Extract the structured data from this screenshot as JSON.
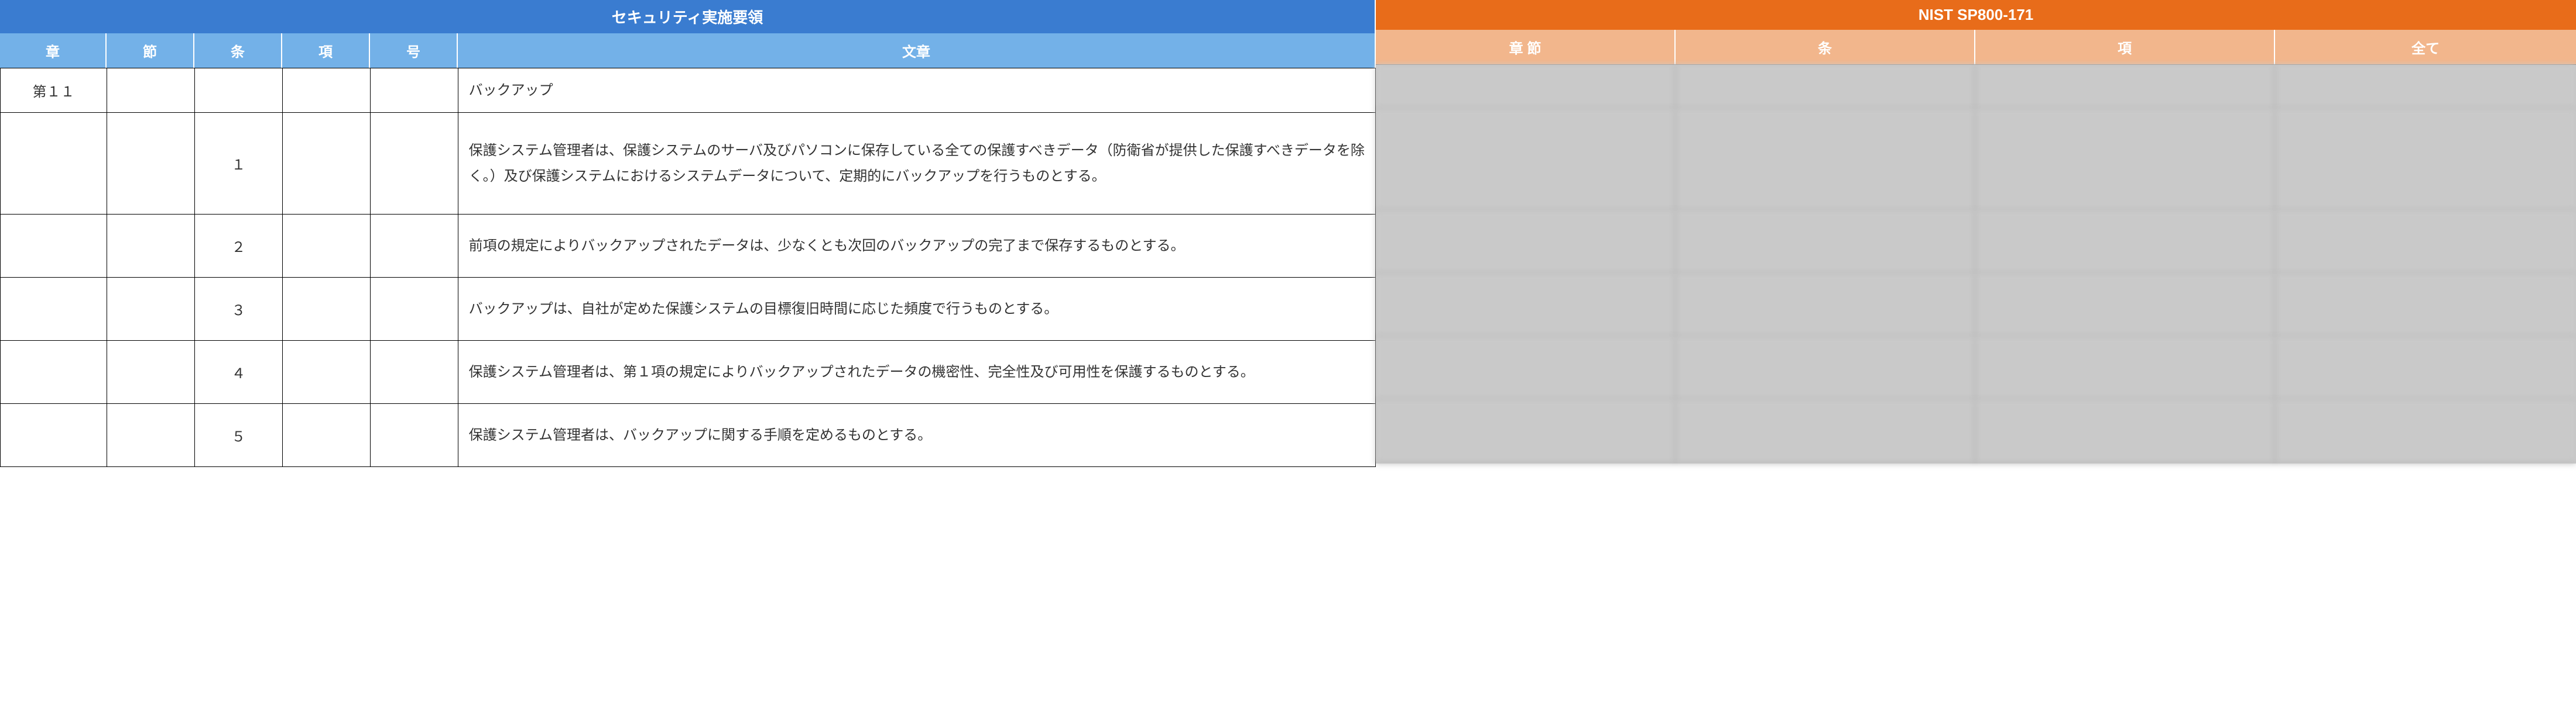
{
  "left": {
    "title": "セキュリティ実施要領",
    "headers": {
      "sho": "章",
      "setsu": "節",
      "jo": "条",
      "kou": "項",
      "gou": "号",
      "bun": "文章"
    },
    "rows": [
      {
        "sho": "第１１",
        "setsu": "",
        "jo": "",
        "kou": "",
        "gou": "",
        "bun": "バックアップ"
      },
      {
        "sho": "",
        "setsu": "",
        "jo": "１",
        "kou": "",
        "gou": "",
        "bun": "保護システム管理者は、保護システムのサーバ及びパソコンに保存している全ての保護すべきデータ（防衛省が提供した保護すべきデータを除く。）及び保護システムにおけるシステムデータについて、定期的にバックアップを行うものとする。"
      },
      {
        "sho": "",
        "setsu": "",
        "jo": "２",
        "kou": "",
        "gou": "",
        "bun": "前項の規定によりバックアップされたデータは、少なくとも次回のバックアップの完了まで保存するものとする。"
      },
      {
        "sho": "",
        "setsu": "",
        "jo": "３",
        "kou": "",
        "gou": "",
        "bun": "バックアップは、自社が定めた保護システムの目標復旧時間に応じた頻度で行うものとする。"
      },
      {
        "sho": "",
        "setsu": "",
        "jo": "４",
        "kou": "",
        "gou": "",
        "bun": "保護システム管理者は、第１項の規定によりバックアップされたデータの機密性、完全性及び可用性を保護するものとする。"
      },
      {
        "sho": "",
        "setsu": "",
        "jo": "５",
        "kou": "",
        "gou": "",
        "bun": "保護システム管理者は、バックアップに関する手順を定めるものとする。"
      }
    ]
  },
  "right": {
    "title": "NIST SP800-171",
    "headers": {
      "c1": "章 節",
      "c2": "条",
      "c3": "項",
      "c4": "全て"
    },
    "rows": [
      {
        "c1": "",
        "c2": "",
        "c3": "",
        "c4": ""
      },
      {
        "c1": "",
        "c2": "",
        "c3": "",
        "c4": ""
      },
      {
        "c1": "",
        "c2": "",
        "c3": "",
        "c4": ""
      },
      {
        "c1": "",
        "c2": "",
        "c3": "",
        "c4": ""
      },
      {
        "c1": "",
        "c2": "",
        "c3": "",
        "c4": ""
      },
      {
        "c1": "",
        "c2": "",
        "c3": "",
        "c4": ""
      }
    ]
  }
}
